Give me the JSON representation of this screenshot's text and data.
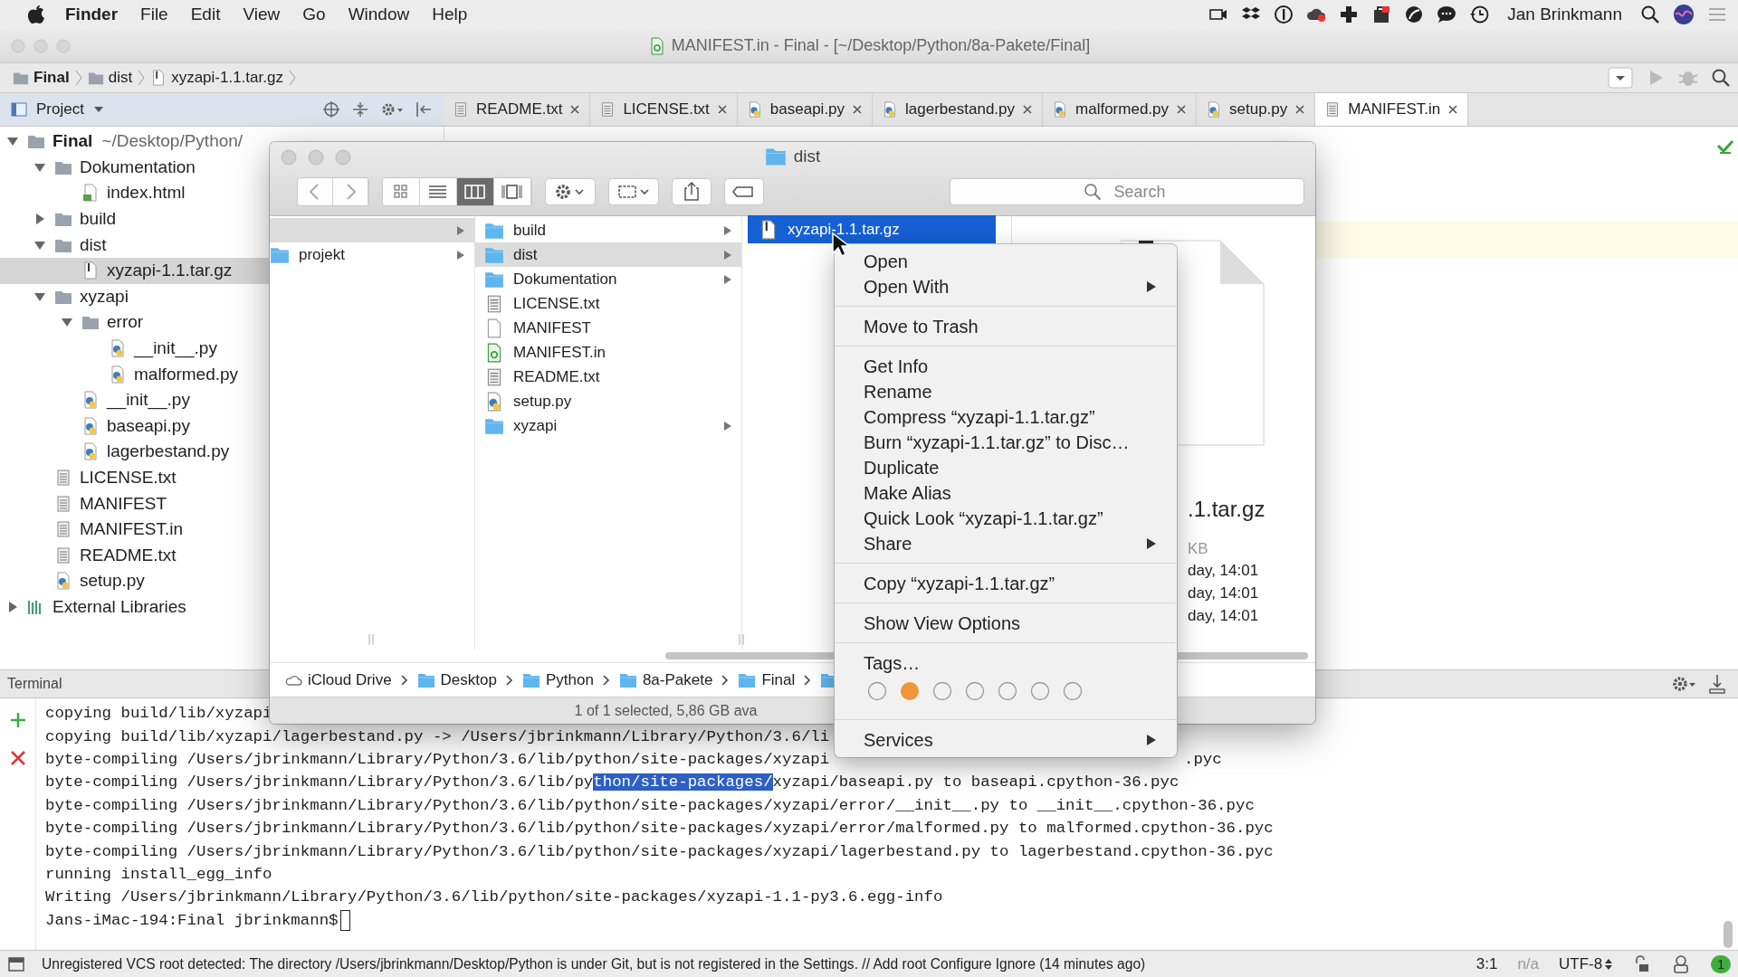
{
  "menubar": {
    "app": "Finder",
    "items": [
      "File",
      "Edit",
      "View",
      "Go",
      "Window",
      "Help"
    ],
    "user": "Jan Brinkmann"
  },
  "window": {
    "title": "MANIFEST.in - Final - [~/Desktop/Python/8a-Pakete/Final]"
  },
  "breadcrumbs": [
    {
      "label": "Final",
      "kind": "folder"
    },
    {
      "label": "dist",
      "kind": "folder"
    },
    {
      "label": "xyzapi-1.1.tar.gz",
      "kind": "archive"
    }
  ],
  "project_panel": {
    "title": "Project"
  },
  "tabs": [
    {
      "label": "README.txt",
      "kind": "text",
      "selected": false
    },
    {
      "label": "LICENSE.txt",
      "kind": "text",
      "selected": false
    },
    {
      "label": "baseapi.py",
      "kind": "python",
      "selected": false
    },
    {
      "label": "lagerbestand.py",
      "kind": "python",
      "selected": false
    },
    {
      "label": "malformed.py",
      "kind": "python",
      "selected": false
    },
    {
      "label": "setup.py",
      "kind": "python",
      "selected": false
    },
    {
      "label": "MANIFEST.in",
      "kind": "text",
      "selected": true
    }
  ],
  "tree": [
    {
      "label": "Final",
      "path": "~/Desktop/Python/",
      "kind": "project",
      "expanded": true,
      "selected": false,
      "children": [
        {
          "label": "Dokumentation",
          "kind": "folder",
          "expanded": true,
          "selected": false,
          "children": [
            {
              "label": "index.html",
              "kind": "html",
              "selected": false
            }
          ]
        },
        {
          "label": "build",
          "kind": "folder",
          "expanded": false,
          "selected": false
        },
        {
          "label": "dist",
          "kind": "folder",
          "expanded": true,
          "selected": false,
          "children": [
            {
              "label": "xyzapi-1.1.tar.gz",
              "kind": "archive",
              "selected": true
            }
          ]
        },
        {
          "label": "xyzapi",
          "kind": "folder",
          "expanded": true,
          "selected": false,
          "children": [
            {
              "label": "error",
              "kind": "folder",
              "expanded": true,
              "selected": false,
              "children": [
                {
                  "label": "__init__.py",
                  "kind": "python",
                  "selected": false
                },
                {
                  "label": "malformed.py",
                  "kind": "python",
                  "selected": false
                }
              ]
            },
            {
              "label": "__init__.py",
              "kind": "python",
              "selected": false
            },
            {
              "label": "baseapi.py",
              "kind": "python",
              "selected": false
            },
            {
              "label": "lagerbestand.py",
              "kind": "python",
              "selected": false
            }
          ]
        },
        {
          "label": "LICENSE.txt",
          "kind": "text",
          "selected": false
        },
        {
          "label": "MANIFEST",
          "kind": "text",
          "selected": false
        },
        {
          "label": "MANIFEST.in",
          "kind": "text",
          "selected": false
        },
        {
          "label": "README.txt",
          "kind": "text",
          "selected": false
        },
        {
          "label": "setup.py",
          "kind": "python",
          "selected": false
        }
      ]
    },
    {
      "label": "External Libraries",
      "kind": "libraries",
      "expanded": false,
      "selected": false
    }
  ],
  "finder": {
    "title": "dist",
    "search": {
      "placeholder": "Search"
    },
    "columns": [
      {
        "focused": false,
        "items": [
          {
            "selected": true,
            "has_children": true
          },
          {
            "label": "projekt",
            "kind": "folder",
            "selected": false,
            "has_children": true
          }
        ]
      },
      {
        "focused": false,
        "items": [
          {
            "label": "build",
            "kind": "folder",
            "selected": false,
            "has_children": true
          },
          {
            "label": "dist",
            "kind": "folder",
            "selected": true,
            "has_children": true
          },
          {
            "label": "Dokumentation",
            "kind": "folder",
            "selected": false,
            "has_children": true
          },
          {
            "label": "LICENSE.txt",
            "kind": "text",
            "selected": false,
            "has_children": false
          },
          {
            "label": "MANIFEST",
            "kind": "doc",
            "selected": false,
            "has_children": false
          },
          {
            "label": "MANIFEST.in",
            "kind": "manifest",
            "selected": false,
            "has_children": false
          },
          {
            "label": "README.txt",
            "kind": "text",
            "selected": false,
            "has_children": false
          },
          {
            "label": "setup.py",
            "kind": "python",
            "selected": false,
            "has_children": false
          },
          {
            "label": "xyzapi",
            "kind": "folder",
            "selected": false,
            "has_children": true
          }
        ]
      },
      {
        "focused": true,
        "items": [
          {
            "label": "xyzapi-1.1.tar.gz",
            "kind": "archive",
            "selected": true,
            "has_children": false
          }
        ]
      }
    ],
    "preview": {
      "name": ".1.tar.gz",
      "size": "KB",
      "dates": [
        "day, 14:01",
        "day, 14:01",
        "day, 14:01"
      ]
    },
    "path": [
      {
        "label": "iCloud Drive",
        "kind": "cloud"
      },
      {
        "label": "Desktop",
        "kind": "folder"
      },
      {
        "label": "Python",
        "kind": "folder"
      },
      {
        "label": "8a-Pakete",
        "kind": "folder"
      },
      {
        "label": "Final",
        "kind": "folder"
      },
      {
        "kind": "folder"
      }
    ],
    "status": "1 of 1 selected, 5,86 GB ava"
  },
  "context_menu": [
    {
      "kind": "item",
      "label": "Open",
      "submenu": false
    },
    {
      "kind": "item",
      "label": "Open With",
      "submenu": true
    },
    {
      "kind": "separator"
    },
    {
      "kind": "item",
      "label": "Move to Trash",
      "submenu": false
    },
    {
      "kind": "separator"
    },
    {
      "kind": "item",
      "label": "Get Info",
      "submenu": false
    },
    {
      "kind": "item",
      "label": "Rename",
      "submenu": false
    },
    {
      "kind": "item",
      "label": "Compress “xyzapi-1.1.tar.gz”",
      "submenu": false
    },
    {
      "kind": "item",
      "label": "Burn “xyzapi-1.1.tar.gz” to Disc…",
      "submenu": false
    },
    {
      "kind": "item",
      "label": "Duplicate",
      "submenu": false
    },
    {
      "kind": "item",
      "label": "Make Alias",
      "submenu": false
    },
    {
      "kind": "item",
      "label": "Quick Look “xyzapi-1.1.tar.gz”",
      "submenu": false
    },
    {
      "kind": "item",
      "label": "Share",
      "submenu": true
    },
    {
      "kind": "separator"
    },
    {
      "kind": "item",
      "label": "Copy “xyzapi-1.1.tar.gz”",
      "submenu": false
    },
    {
      "kind": "separator"
    },
    {
      "kind": "item",
      "label": "Show View Options",
      "submenu": false
    },
    {
      "kind": "separator"
    },
    {
      "kind": "item",
      "label": "Tags…",
      "submenu": false
    },
    {
      "kind": "tag_dots",
      "dots": [
        {
          "filled": false
        },
        {
          "filled": true
        },
        {
          "filled": false
        },
        {
          "filled": false
        },
        {
          "filled": false
        },
        {
          "filled": false
        },
        {
          "filled": false
        }
      ]
    },
    {
      "kind": "separator"
    },
    {
      "kind": "item",
      "label": "Services",
      "submenu": true
    }
  ],
  "terminal": {
    "title": "Terminal",
    "lines": [
      {
        "segments": [
          {
            "text": "copying build/lib/xyzapi",
            "selected": false
          }
        ]
      },
      {
        "segments": [
          {
            "text": "copying build/lib/xyzapi/lagerbestand.py -> /Users/jbrinkmann/Library/Python/3.6/li",
            "selected": false
          }
        ]
      },
      {
        "segments": [
          {
            "text": "byte-compiling /Users/jbrinkmann/Library/Python/3.6/lib/python/site-packages/xyzapi",
            "selected": false
          }
        ],
        "tail": ".pyc"
      },
      {
        "segments": [
          {
            "text": "byte-compiling /Users/jbrinkmann/Library/Python/3.6/lib/py",
            "selected": false
          },
          {
            "text": "thon/site-packages/",
            "selected": true
          },
          {
            "text": "xyzapi/baseapi.py to baseapi.cpython-36.pyc",
            "selected": false
          }
        ]
      },
      {
        "segments": [
          {
            "text": "byte-compiling /Users/jbrinkmann/Library/Python/3.6/lib/python/site-packages/xyzapi/error/__init__.py to __init__.cpython-36.pyc",
            "selected": false
          }
        ]
      },
      {
        "segments": [
          {
            "text": "byte-compiling /Users/jbrinkmann/Library/Python/3.6/lib/python/site-packages/xyzapi/error/malformed.py to malformed.cpython-36.pyc",
            "selected": false
          }
        ]
      },
      {
        "segments": [
          {
            "text": "byte-compiling /Users/jbrinkmann/Library/Python/3.6/lib/python/site-packages/xyzapi/lagerbestand.py to lagerbestand.cpython-36.pyc",
            "selected": false
          }
        ]
      },
      {
        "segments": [
          {
            "text": "running install_egg_info",
            "selected": false
          }
        ]
      },
      {
        "segments": [
          {
            "text": "Writing /Users/jbrinkmann/Library/Python/3.6/lib/python/site-packages/xyzapi-1.1-py3.6.egg-info",
            "selected": false
          }
        ]
      },
      {
        "segments": [
          {
            "text": "Jans-iMac-194:Final jbrinkmann$",
            "selected": false
          }
        ],
        "cursor": true
      }
    ]
  },
  "status_bar": {
    "message": "Unregistered VCS root detected: The directory /Users/jbrinkmann/Desktop/Python is under Git, but is not registered in the Settings. // Add root  Configure  Ignore (14 minutes ago)",
    "position": "3:1",
    "vcs": "n/a",
    "encoding": "UTF-8",
    "notifications": "1"
  }
}
